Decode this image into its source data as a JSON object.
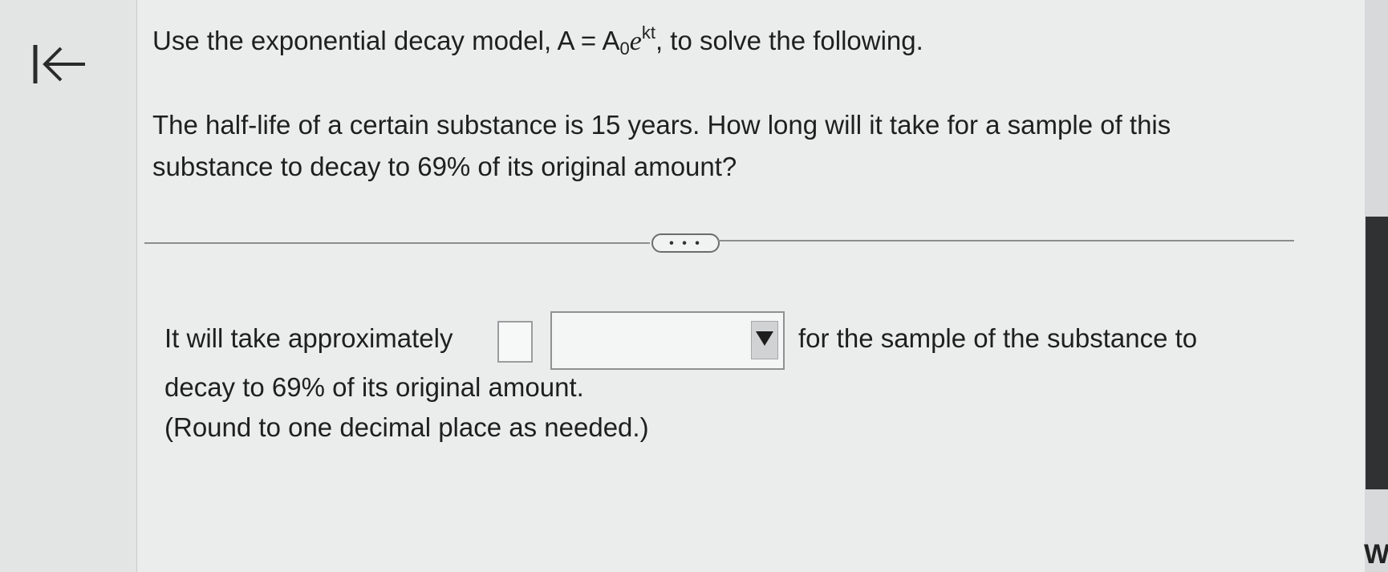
{
  "navigation": {
    "back_icon": "first-page-arrow-icon"
  },
  "question": {
    "title_prefix": "Use the exponential decay model, A = A",
    "title_subscript": "0",
    "title_base": "e",
    "title_superscript": "kt",
    "title_suffix": ", to solve the following.",
    "text": "The half-life of a certain substance is 15 years. How long will it take for a sample of this substance to decay to 69% of its original amount?"
  },
  "divider": {
    "more_label": "• • •"
  },
  "answer": {
    "prefix": "It will take approximately",
    "input_value": "",
    "unit_selected": "",
    "dropdown_icon": "dropdown-arrow-icon",
    "suffix_line1": "for the sample of the substance to",
    "line2": "decay to 69% of its original amount.",
    "hint": "(Round to one decimal place as needed.)"
  },
  "edge": {
    "letter": "W"
  },
  "colors": {
    "background": "#ebecec",
    "text": "#1f1f1f",
    "right_panel": "#2f3133"
  }
}
